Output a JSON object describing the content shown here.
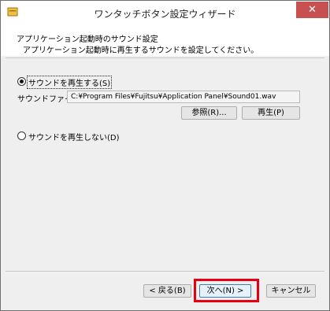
{
  "window": {
    "title": "ワンタッチボタン設定ウィザード",
    "close_label": "✕",
    "app_icon": "wizard-app-icon"
  },
  "header": {
    "title": "アプリケーション起動時のサウンド設定",
    "subtitle": "アプリケーション起動時に再生するサウンドを設定してください。"
  },
  "options": {
    "play": {
      "label": "サウンドを再生する(S)",
      "selected": true
    },
    "sound_file_label": "サウンドファイル:",
    "sound_file_value": "C:¥Program Files¥Fujitsu¥Application Panel¥Sound01.wav",
    "browse_label": "参照(R)...",
    "play_button_label": "再生(P)",
    "no_play": {
      "label": "サウンドを再生しない(D)",
      "selected": false
    }
  },
  "footer": {
    "back_label": "< 戻る(B)",
    "next_label": "次へ(N) >",
    "cancel_label": "キャンセル"
  },
  "colors": {
    "highlight": "#e60012",
    "close_button": "#c75050"
  }
}
